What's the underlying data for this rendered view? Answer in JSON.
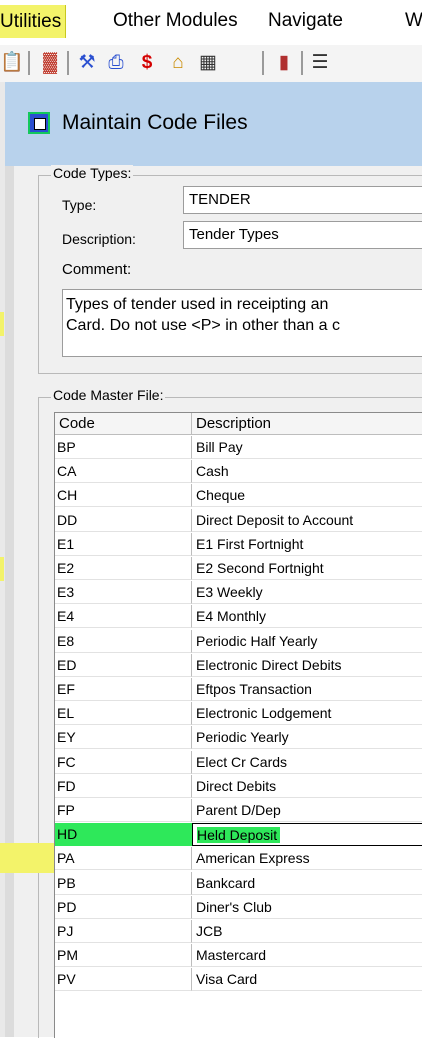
{
  "menu": {
    "items": [
      "Utilities",
      "Other Modules",
      "Navigate",
      "W"
    ]
  },
  "toolbar": {
    "icons": [
      "paste-icon",
      "chart-icon",
      "tools-icon",
      "print-icon",
      "dollar-icon",
      "home-icon",
      "book-icon",
      "door-icon",
      "list-icon"
    ]
  },
  "dialog": {
    "title": "Maintain Code Files",
    "code_types": {
      "group_label": "Code Types:",
      "type_label": "Type:",
      "type_value": "TENDER",
      "description_label": "Description:",
      "description_value": "Tender Types",
      "comment_label": "Comment:",
      "comment_lines": [
        "Types of tender used in receipting an",
        "Card. Do not use <P> in other than a c"
      ]
    },
    "code_master": {
      "group_label": "Code Master File:",
      "columns": [
        "Code",
        "Description"
      ],
      "rows": [
        {
          "code": "BP",
          "description": "Bill Pay"
        },
        {
          "code": "CA",
          "description": "Cash"
        },
        {
          "code": "CH",
          "description": "Cheque"
        },
        {
          "code": "DD",
          "description": "Direct Deposit to Account"
        },
        {
          "code": "E1",
          "description": "E1 First Fortnight"
        },
        {
          "code": "E2",
          "description": "E2 Second Fortnight"
        },
        {
          "code": "E3",
          "description": "E3 Weekly"
        },
        {
          "code": "E4",
          "description": "E4 Monthly"
        },
        {
          "code": "E8",
          "description": "Periodic Half Yearly"
        },
        {
          "code": "ED",
          "description": "Electronic Direct Debits"
        },
        {
          "code": "EF",
          "description": "Eftpos Transaction"
        },
        {
          "code": "EL",
          "description": "Electronic Lodgement"
        },
        {
          "code": "EY",
          "description": "Periodic Yearly"
        },
        {
          "code": "FC",
          "description": "Elect Cr Cards"
        },
        {
          "code": "FD",
          "description": "Direct Debits"
        },
        {
          "code": "FP",
          "description": "Parent D/Dep"
        },
        {
          "code": "HD",
          "description": "Held Deposit"
        },
        {
          "code": "PA",
          "description": "American Express"
        },
        {
          "code": "PB",
          "description": "Bankcard"
        },
        {
          "code": "PD",
          "description": "Diner's Club"
        },
        {
          "code": "PJ",
          "description": "JCB"
        },
        {
          "code": "PM",
          "description": "Mastercard"
        },
        {
          "code": "PV",
          "description": "Visa Card"
        }
      ],
      "selected_code": "HD"
    }
  },
  "colors": {
    "highlight_yellow": "#f3f36a",
    "highlight_green": "#2ee85a",
    "titlebar": "#b8d2ec"
  }
}
